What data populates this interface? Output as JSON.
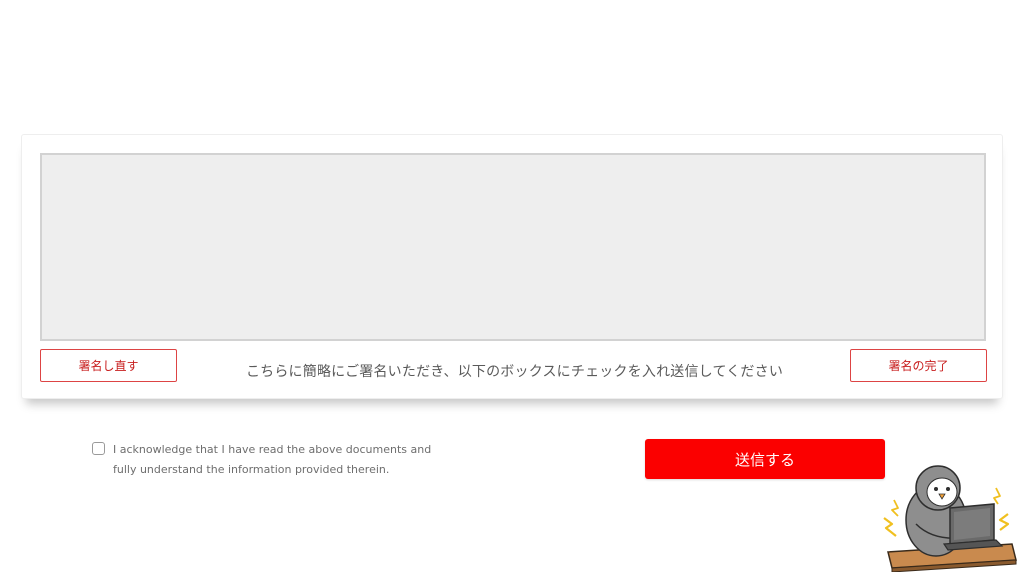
{
  "signature": {
    "redo_label": "署名し直す",
    "done_label": "署名の完了",
    "instruction": "こちらに簡略にご署名いただき、以下のボックスにチェックを入れ送信してください"
  },
  "acknowledgement": {
    "text": "I acknowledge that I have read the above documents and fully understand the information provided therein.",
    "checked": false
  },
  "submit": {
    "label": "送信する"
  },
  "colors": {
    "accent": "#fb0000",
    "outline_red": "#dd4444",
    "canvas_bg": "#eeeeee"
  },
  "illustration": {
    "icon": "penguin-laptop-mascot-icon"
  }
}
